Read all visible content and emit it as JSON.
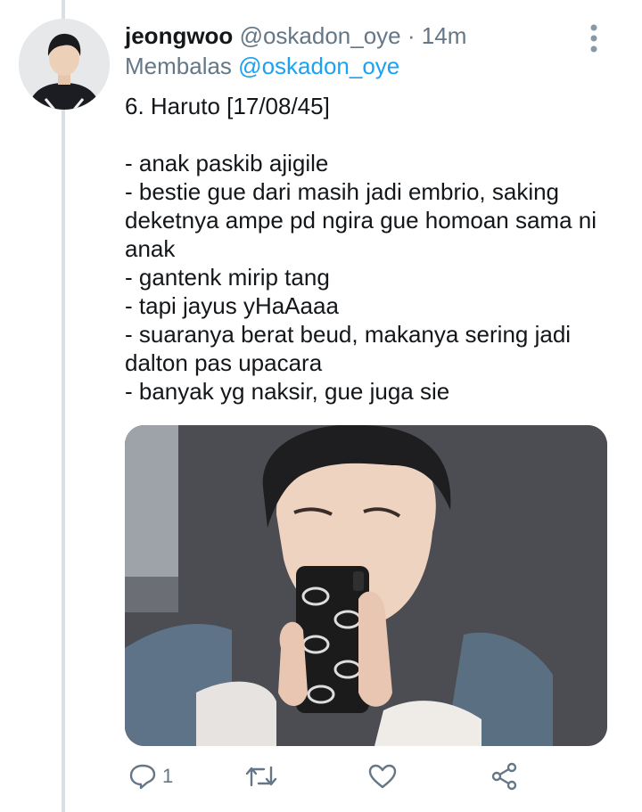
{
  "tweet": {
    "display_name": "jeongwoo",
    "handle": "@oskadon_oye",
    "separator": "·",
    "time": "14m",
    "reply_prefix": "Membalas",
    "reply_to": "@oskadon_oye",
    "lines": [
      "6. Haruto [17/08/45]",
      "- anak paskib ajigile",
      "- bestie gue dari masih jadi embrio, saking deketnya ampe pd ngira gue homoan sama ni anak",
      "- gantenk mirip tang",
      "- tapi jayus yHaAaaa",
      "- suaranya berat beud, makanya sering jadi dalton pas upacara",
      "- banyak yg naksir, gue juga sie"
    ]
  },
  "actions": {
    "reply_count": "1",
    "icons": [
      "reply-icon",
      "retweet-icon",
      "like-icon",
      "share-icon"
    ]
  },
  "colors": {
    "accent": "#1da1f2",
    "muted": "#657786",
    "text": "#14171a",
    "thread_line": "#d9dfe3"
  }
}
